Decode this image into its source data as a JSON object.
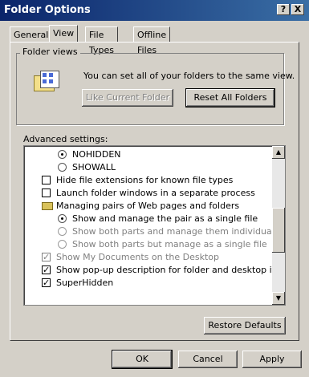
{
  "window": {
    "title": "Folder Options",
    "help_btn": "?",
    "close_btn": "X"
  },
  "tabs": [
    {
      "label": "General"
    },
    {
      "label": "View"
    },
    {
      "label": "File Types"
    },
    {
      "label": "Offline Files"
    }
  ],
  "folder_views": {
    "label": "Folder views",
    "text": "You can set all of your folders to the same view.",
    "like_current": "Like Current Folder",
    "reset_all": "Reset All Folders"
  },
  "advanced": {
    "label": "Advanced settings:",
    "items": [
      {
        "text": "NOHIDDEN",
        "type": "radio",
        "checked": true
      },
      {
        "text": "SHOWALL",
        "type": "radio",
        "checked": false
      },
      {
        "text": "Hide file extensions for known file types",
        "type": "checkbox",
        "checked": false
      },
      {
        "text": "Launch folder windows in a separate process",
        "type": "checkbox",
        "checked": false
      },
      {
        "text": "Managing pairs of Web pages and folders",
        "type": "folder"
      },
      {
        "text": "Show and manage the pair as a single file",
        "type": "radio",
        "checked": true
      },
      {
        "text": "Show both parts and manage them individually",
        "type": "radio",
        "checked": false,
        "disabled": true
      },
      {
        "text": "Show both parts but manage as a single file",
        "type": "radio",
        "checked": false,
        "disabled": true
      },
      {
        "text": "Show My Documents on the Desktop",
        "type": "checkbox",
        "checked": true,
        "disabled": true
      },
      {
        "text": "Show pop-up description for folder and desktop items",
        "type": "checkbox",
        "checked": true
      },
      {
        "text": "SuperHidden",
        "type": "checkbox",
        "checked": true
      }
    ]
  },
  "restore_defaults": "Restore Defaults",
  "footer": {
    "ok": "OK",
    "cancel": "Cancel",
    "apply": "Apply"
  }
}
